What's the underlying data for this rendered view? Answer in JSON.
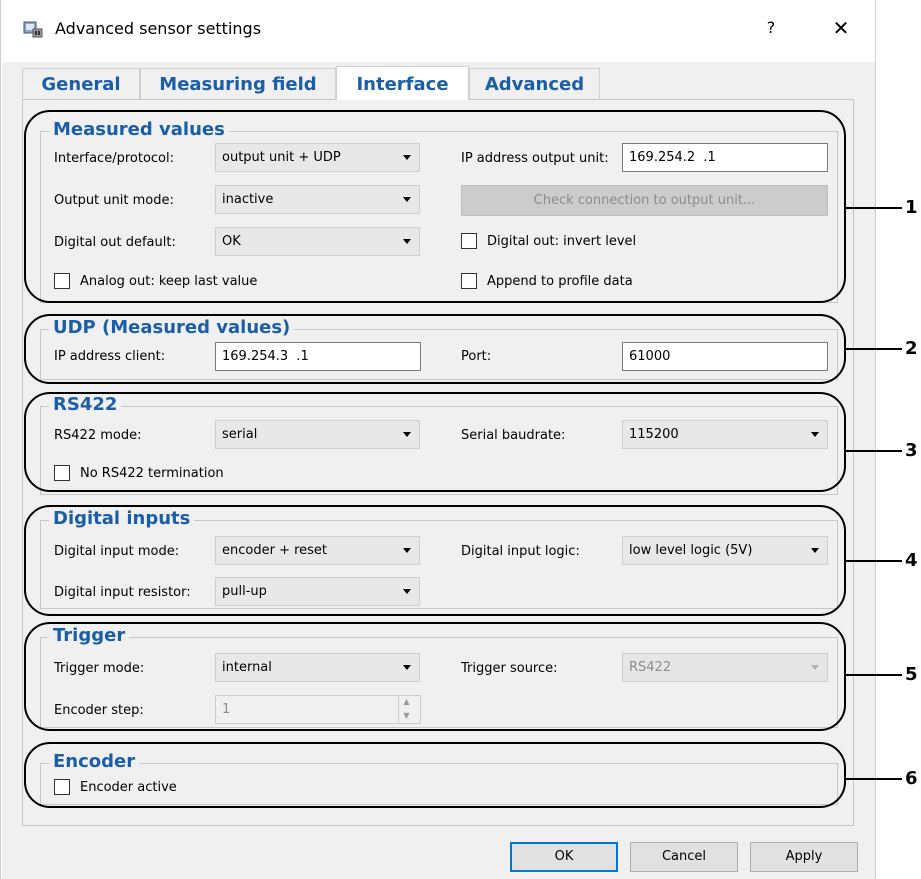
{
  "window": {
    "title": "Advanced sensor settings",
    "help_label": "?",
    "close_label": "✕"
  },
  "tabs": [
    {
      "label": "General"
    },
    {
      "label": "Measuring field"
    },
    {
      "label": "Interface"
    },
    {
      "label": "Advanced"
    }
  ],
  "measured_values": {
    "title": "Measured values",
    "interface_label": "Interface/protocol:",
    "interface_value": "output unit + UDP",
    "ip_output_label": "IP address output unit:",
    "ip_output_value": "169.254.2  .1",
    "output_mode_label": "Output unit mode:",
    "output_mode_value": "inactive",
    "check_button": "Check connection to output unit...",
    "digital_out_label": "Digital out default:",
    "digital_out_value": "OK",
    "invert_level_label": "Digital out: invert level",
    "analog_keep_label": "Analog out: keep last value",
    "append_label": "Append to profile data"
  },
  "udp": {
    "title": "UDP (Measured values)",
    "ip_client_label": "IP address client:",
    "ip_client_value": "169.254.3  .1",
    "port_label": "Port:",
    "port_value": "61000"
  },
  "rs422": {
    "title": "RS422",
    "mode_label": "RS422 mode:",
    "mode_value": "serial",
    "baud_label": "Serial baudrate:",
    "baud_value": "115200",
    "no_term_label": "No RS422 termination"
  },
  "digital_inputs": {
    "title": "Digital inputs",
    "mode_label": "Digital input mode:",
    "mode_value": "encoder + reset",
    "logic_label": "Digital input logic:",
    "logic_value": "low level logic (5V)",
    "resistor_label": "Digital input resistor:",
    "resistor_value": "pull-up"
  },
  "trigger": {
    "title": "Trigger",
    "mode_label": "Trigger mode:",
    "mode_value": "internal",
    "source_label": "Trigger source:",
    "source_value": "RS422",
    "encoder_step_label": "Encoder step:",
    "encoder_step_value": "1"
  },
  "encoder": {
    "title": "Encoder",
    "active_label": "Encoder active"
  },
  "buttons": {
    "ok": "OK",
    "cancel": "Cancel",
    "apply": "Apply"
  },
  "callouts": [
    "1",
    "2",
    "3",
    "4",
    "5",
    "6"
  ]
}
